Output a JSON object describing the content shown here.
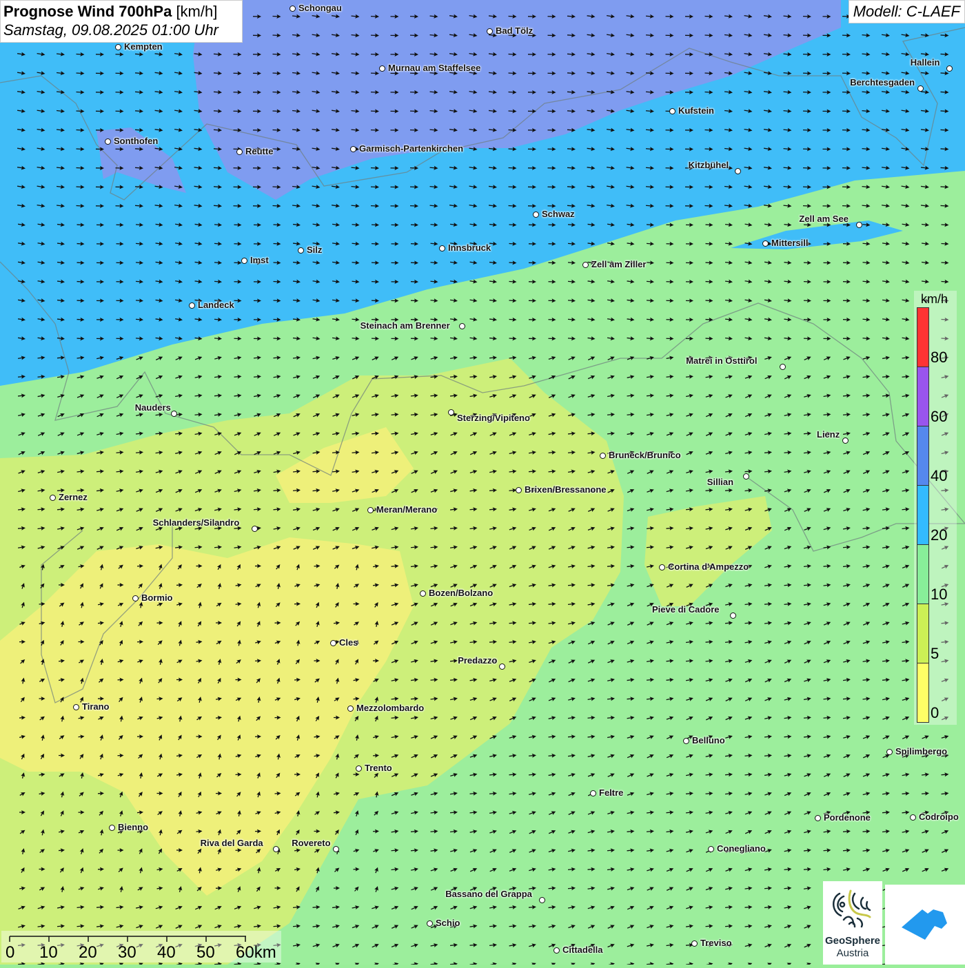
{
  "header": {
    "title": "Prognose Wind 700hPa",
    "unit": "[km/h]",
    "datetime": "Samstag, 09.08.2025 01:00 Uhr"
  },
  "model": "Modell: C-LAEF",
  "legend": {
    "unit": "km/h",
    "levels": [
      {
        "label": "80",
        "color": "#ff3333"
      },
      {
        "label": "60",
        "color": "#9955ee"
      },
      {
        "label": "40",
        "color": "#5588ee"
      },
      {
        "label": "20",
        "color": "#33bbff"
      },
      {
        "label": "10",
        "color": "#88ee99"
      },
      {
        "label": "5",
        "color": "#ccf055"
      },
      {
        "label": "0",
        "color": "#ffff66"
      }
    ]
  },
  "scale_bar": {
    "labels": [
      "0",
      "10",
      "20",
      "30",
      "40",
      "50",
      "60km"
    ]
  },
  "cities": [
    "Schongau",
    "Bad Tölz",
    "Kempten",
    "Murnau am Staffelsee",
    "Hallein",
    "Berchtesgaden",
    "Kufstein",
    "Sonthofen",
    "Reutte",
    "Garmisch-Partenkirchen",
    "Kitzbühel",
    "Schwaz",
    "Zell am See",
    "Mittersill",
    "Innsbruck",
    "Imst",
    "Silz",
    "Zell am Ziller",
    "Landeck",
    "Steinach am Brenner",
    "Matrei in Osttirol",
    "Nauders",
    "Sterzing/Vipiteno",
    "Lienz",
    "Bruneck/Brunico",
    "Sillian",
    "Brixen/Bressanone",
    "Zernez",
    "Meran/Merano",
    "Schlanders/Silandro",
    "Cortina d'Ampezzo",
    "Bozen/Bolzano",
    "Bormio",
    "Pieve di Cadore",
    "Cles",
    "Predazzo",
    "Tirano",
    "Mezzolombardo",
    "Belluno",
    "Spilimbergo",
    "Trento",
    "Feltre",
    "Pordenone",
    "Codroipo",
    "Bienno",
    "Riva del Garda",
    "Rovereto",
    "Conegliano",
    "Bassano del Grappa",
    "Schio",
    "Treviso",
    "Cittadella"
  ],
  "logos": {
    "geosphere_line1": "GeoSphere",
    "geosphere_line2": "Austria"
  },
  "colors": {
    "purple_zone": "#7f9cf0",
    "cyan_zone": "#40bdf8",
    "green_zone": "#9cee9c",
    "lime_zone": "#cdef7a",
    "yellow_zone": "#eef07a"
  }
}
